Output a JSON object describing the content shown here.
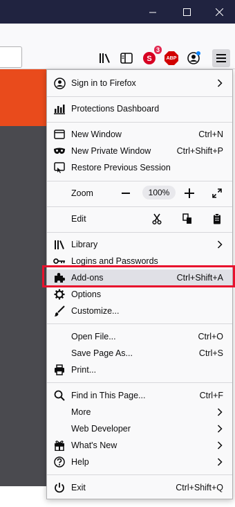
{
  "window": {
    "minimize_icon": "minimize-icon",
    "maximize_icon": "maximize-icon",
    "close_icon": "close-icon"
  },
  "toolbar": {
    "notification_badge": "3",
    "adblock_label": "ABP",
    "colors": {
      "titlebar": "#202340",
      "badge": "#e22850",
      "abp": "#d10000",
      "page_accent": "#e94b1c"
    }
  },
  "menu": {
    "sign_in": "Sign in to Firefox",
    "protections": "Protections Dashboard",
    "new_window": {
      "label": "New Window",
      "shortcut": "Ctrl+N"
    },
    "new_private_window": {
      "label": "New Private Window",
      "shortcut": "Ctrl+Shift+P"
    },
    "restore_session": "Restore Previous Session",
    "zoom": {
      "label": "Zoom",
      "level": "100%"
    },
    "edit": {
      "label": "Edit"
    },
    "library": "Library",
    "logins": "Logins and Passwords",
    "addons": {
      "label": "Add-ons",
      "shortcut": "Ctrl+Shift+A"
    },
    "options": "Options",
    "customize": "Customize...",
    "open_file": {
      "label": "Open File...",
      "shortcut": "Ctrl+O"
    },
    "save_page": {
      "label": "Save Page As...",
      "shortcut": "Ctrl+S"
    },
    "print": "Print...",
    "find": {
      "label": "Find in This Page...",
      "shortcut": "Ctrl+F"
    },
    "more": "More",
    "web_developer": "Web Developer",
    "whats_new": "What's New",
    "help": "Help",
    "exit": {
      "label": "Exit",
      "shortcut": "Ctrl+Shift+Q"
    },
    "highlight_color": "#e8112d"
  }
}
